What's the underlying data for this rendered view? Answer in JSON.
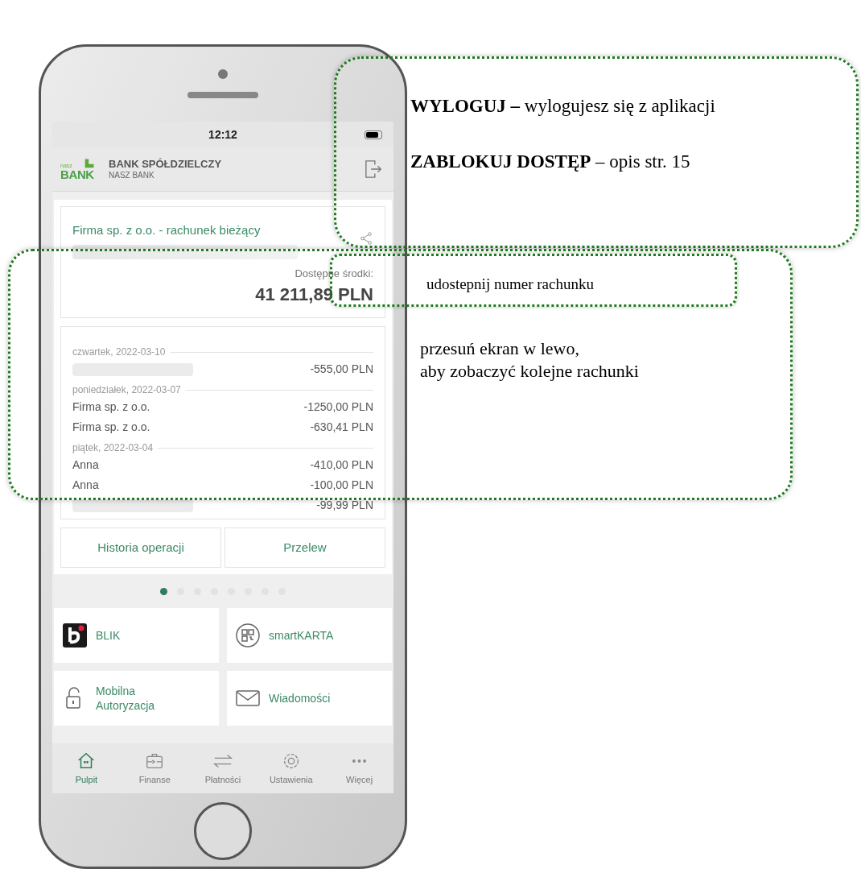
{
  "phone": {
    "status_bar": {
      "time": "12:12"
    },
    "header": {
      "logo_small": "nasz",
      "logo_big": "BANK",
      "bank_name": "BANK SPÓŁDZIELCZY",
      "bank_subname": "NASZ BANK"
    },
    "account": {
      "name": "Firma sp. z o.o. - rachunek bieżący",
      "balance_label": "Dostępne środki:",
      "balance": "41 211,89 PLN"
    },
    "history": [
      {
        "date": "czwartek, 2022-03-10",
        "transactions": [
          {
            "amount": "-555,00 PLN"
          }
        ]
      },
      {
        "date": "poniedziałek, 2022-03-07",
        "transactions": [
          {
            "payee": "Firma sp. z o.o.",
            "amount": "-1250,00 PLN"
          },
          {
            "payee": "Firma sp. z o.o.",
            "amount": "-630,41 PLN"
          }
        ]
      },
      {
        "date": "piątek, 2022-03-04",
        "transactions": [
          {
            "payee": "Anna",
            "amount": "-410,00 PLN"
          },
          {
            "payee": "Anna",
            "amount": "-100,00 PLN"
          },
          {
            "amount": "-99,99 PLN"
          }
        ]
      }
    ],
    "buttons": [
      "Historia operacji",
      "Przelew"
    ],
    "pages": [
      {
        "selected": true
      },
      {
        "selected": false
      },
      {
        "selected": false
      },
      {
        "selected": false
      },
      {
        "selected": false
      },
      {
        "selected": false
      },
      {
        "selected": false
      },
      {
        "selected": false
      }
    ],
    "tiles": [
      {
        "kind": "blik",
        "label": "BLIK"
      },
      {
        "kind": "qr",
        "label": "smartKARTA"
      },
      {
        "kind": "lock",
        "label": "Mobilna Autoryzacja"
      },
      {
        "kind": "mail",
        "label": "Wiadomości"
      }
    ],
    "tabs": [
      {
        "kind": "home",
        "label": "Pulpit",
        "selected": true
      },
      {
        "kind": "wallet",
        "label": "Finanse",
        "selected": false
      },
      {
        "kind": "transfer",
        "label": "Płatności",
        "selected": false
      },
      {
        "kind": "gear",
        "label": "Ustawienia",
        "selected": false
      },
      {
        "kind": "more",
        "label": "Więcej",
        "selected": false
      }
    ]
  },
  "callouts": {
    "logout": [
      "**WYLOGUJ –** wylogujesz się z aplikacji",
      "**ZABLOKUJ DOSTĘP** – opis str. 15"
    ],
    "share": "udostepnij numer rachunku",
    "swipe": [
      "przesuń ekran w lewo,",
      "aby zobaczyć kolejne rachunki"
    ]
  }
}
